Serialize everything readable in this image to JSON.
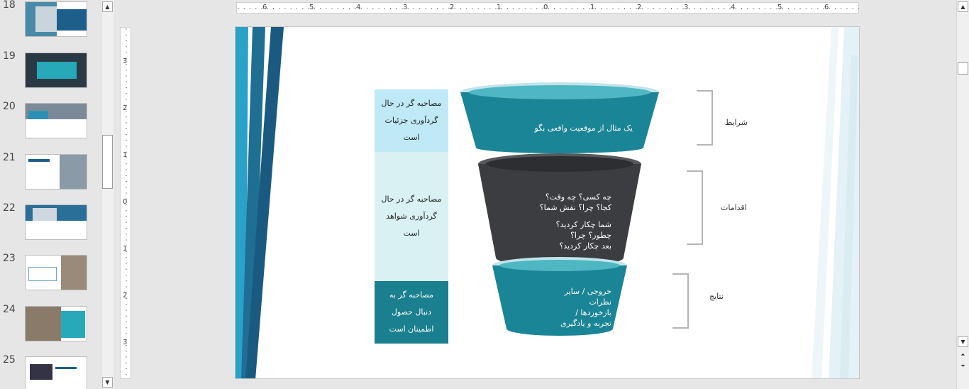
{
  "thumbnails": [
    {
      "number": "18"
    },
    {
      "number": "19"
    },
    {
      "number": "20"
    },
    {
      "number": "21"
    },
    {
      "number": "22"
    },
    {
      "number": "23"
    },
    {
      "number": "24"
    },
    {
      "number": "25"
    }
  ],
  "ruler": {
    "h_labels": [
      "6",
      "5",
      "4",
      "3",
      "2",
      "1",
      "0",
      "1",
      "2",
      "3",
      "4",
      "5",
      "6"
    ],
    "v_labels": [
      "3",
      "2",
      "1",
      "0",
      "1",
      "2",
      "3"
    ]
  },
  "slide": {
    "stages": [
      {
        "text": "مصاحبه گر در حال گردآوری جزئیات است",
        "bg": "#bfe9f6",
        "color": "#222222"
      },
      {
        "text": "مصاحبه گر در حال گردآوری شواهد است",
        "bg": "#daf1f3",
        "color": "#222222"
      },
      {
        "text": "مصاحبه گر به دنبال حصول اطمینان است",
        "bg": "#1a7f8e",
        "color": "#ffffff"
      }
    ],
    "funnel": {
      "top_text": "یک مثال از موقعیت واقعی بگو",
      "middle_lines": [
        "چه کسی؟ چه وقت؟",
        "کجا؟ چرا؟ نقش شما؟",
        "شما چکار کردید؟",
        "چطور؟ چرا؟",
        "بعد چکار کردید؟"
      ],
      "bottom_lines": [
        "خروجی / سایر نظرات",
        "بازخوردها /",
        "تجربه و یادگیری"
      ]
    },
    "labels": {
      "conditions": "شرایط",
      "actions": "اقدامات",
      "results": "نتایج"
    },
    "colors": {
      "teal": "#1a8597",
      "teal_light": "#4fb6c3",
      "dark": "#3b3d40",
      "stripe_dark": "#1e6f92",
      "stripe_light": "#2aa1c6"
    }
  }
}
